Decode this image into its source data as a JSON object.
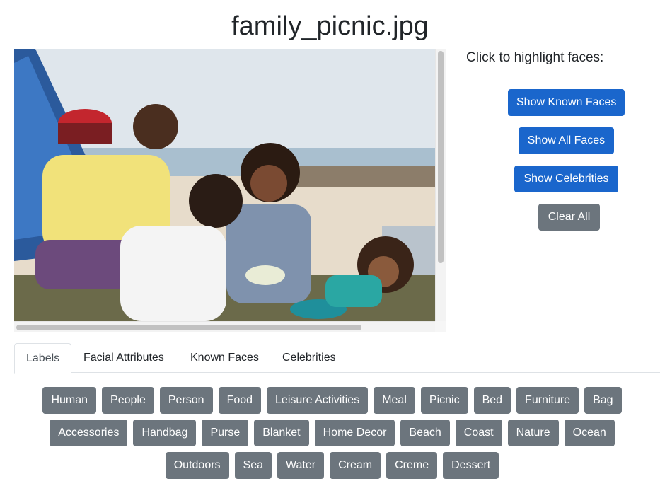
{
  "page": {
    "title": "family_picnic.jpg"
  },
  "panel": {
    "heading": "Click to highlight faces:",
    "buttons": {
      "known": "Show Known Faces",
      "all": "Show All Faces",
      "celebrities": "Show Celebrities",
      "clear": "Clear All"
    }
  },
  "tabs": [
    "Labels",
    "Facial Attributes",
    "Known Faces",
    "Celebrities"
  ],
  "active_tab": "Labels",
  "labels": {
    "row1": [
      "Human",
      "People",
      "Person",
      "Food",
      "Leisure Activities",
      "Meal",
      "Picnic",
      "Bed",
      "Furniture",
      "Bag"
    ],
    "row2": [
      "Accessories",
      "Handbag",
      "Purse",
      "Blanket",
      "Home Decor",
      "Beach",
      "Coast",
      "Nature",
      "Ocean"
    ],
    "row3": [
      "Outdoors",
      "Sea",
      "Water",
      "Cream",
      "Creme",
      "Dessert"
    ]
  },
  "colors": {
    "primary": "#1a66cc",
    "secondary": "#6c757d"
  }
}
